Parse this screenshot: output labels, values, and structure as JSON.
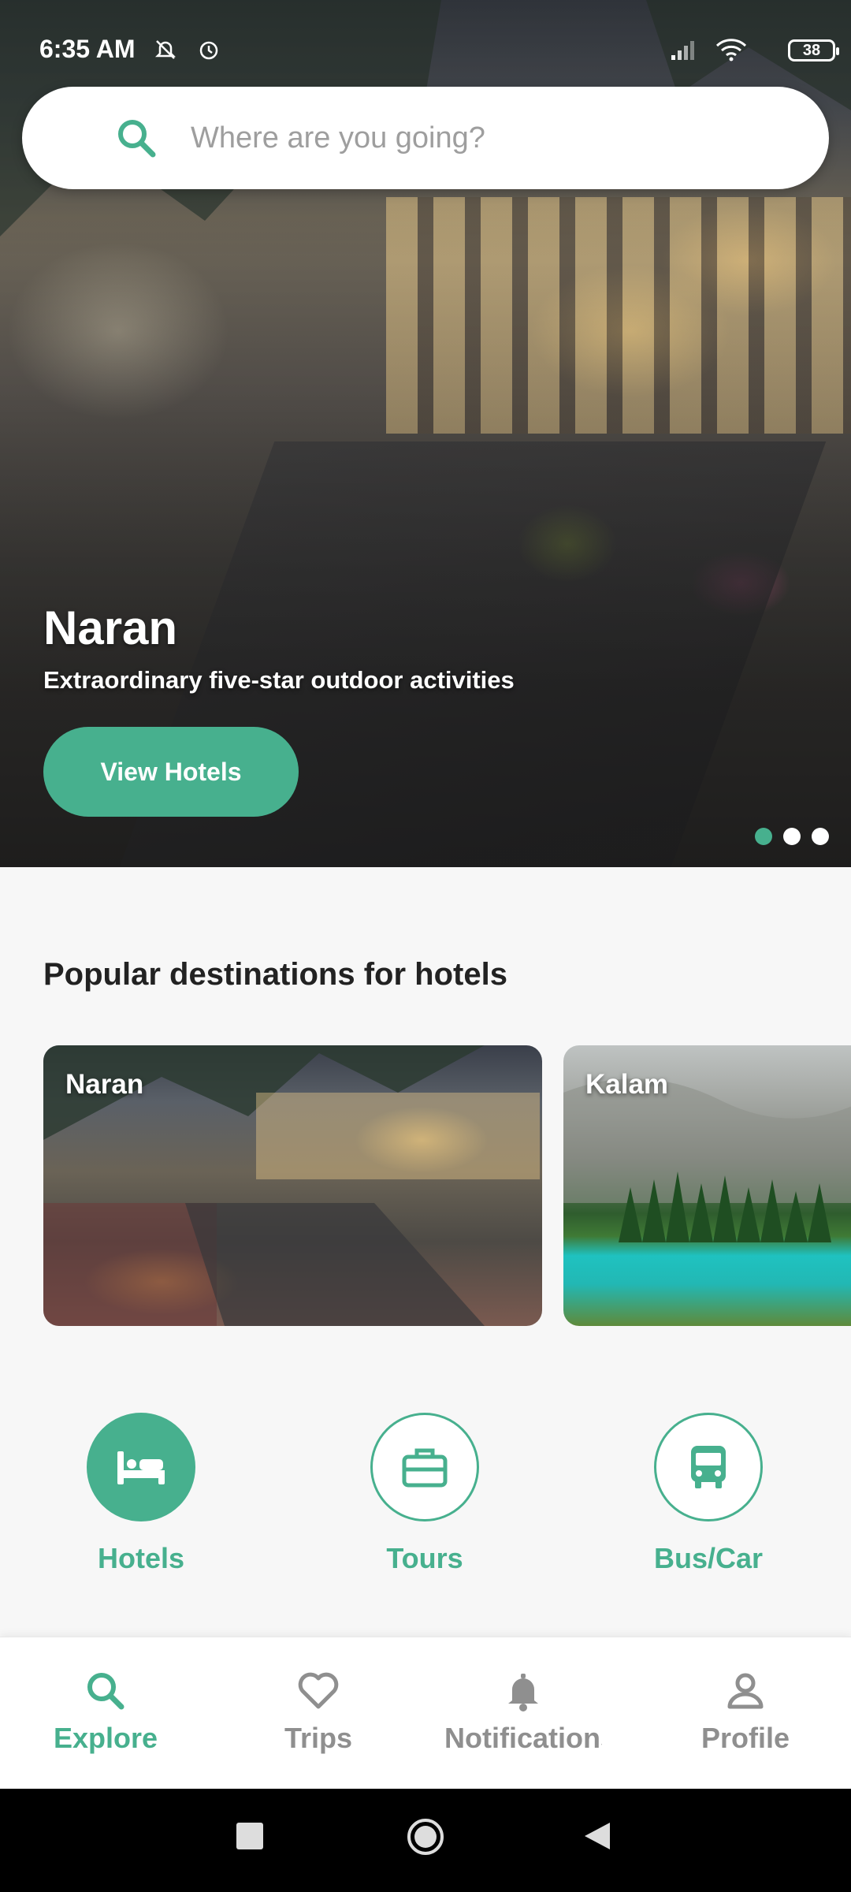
{
  "status_bar": {
    "time": "6:35 AM",
    "battery": "38"
  },
  "search": {
    "placeholder": "Where are you going?",
    "icon": "search-icon"
  },
  "hero": {
    "title": "Naran",
    "subtitle": "Extraordinary five-star outdoor activities",
    "button_label": "View Hotels",
    "page_count": 3,
    "active_page": 1
  },
  "popular": {
    "title": "Popular destinations for hotels",
    "cards": [
      {
        "label": "Naran"
      },
      {
        "label": "Kalam"
      }
    ]
  },
  "categories": [
    {
      "label": "Hotels",
      "icon": "bed-icon",
      "selected": true
    },
    {
      "label": "Tours",
      "icon": "briefcase-icon",
      "selected": false
    },
    {
      "label": "Bus/Car",
      "icon": "bus-icon",
      "selected": false
    }
  ],
  "bottom_nav": [
    {
      "label": "Explore",
      "icon": "search-icon",
      "active": true
    },
    {
      "label": "Trips",
      "icon": "heart-icon",
      "active": false
    },
    {
      "label": "Notifications",
      "icon": "bell-icon",
      "active": false
    },
    {
      "label": "Profile",
      "icon": "person-icon",
      "active": false
    }
  ],
  "colors": {
    "accent": "#47b08e",
    "inactive": "#8f8f8f"
  }
}
